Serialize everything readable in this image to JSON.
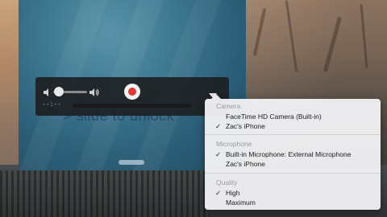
{
  "lock_screen": {
    "unlock_text": "> slide to unlock"
  },
  "controller": {
    "time": "--:--",
    "icons": {
      "volume_low": "speaker-low-icon",
      "volume_high": "speaker-high-icon",
      "record": "record-icon",
      "menu": "chevron-down-icon"
    },
    "volume_level": 0.05,
    "record_color": "#e03a34"
  },
  "menu": {
    "sections": [
      {
        "header": "Camera",
        "items": [
          {
            "label": "FaceTime HD Camera (Built-in)",
            "checked": false
          },
          {
            "label": "Zac's iPhone",
            "checked": true
          }
        ]
      },
      {
        "header": "Microphone",
        "items": [
          {
            "label": "Built-in Microphone: External Microphone",
            "checked": true
          },
          {
            "label": "Zac's iPhone",
            "checked": false
          }
        ]
      },
      {
        "header": "Quality",
        "items": [
          {
            "label": "High",
            "checked": true
          },
          {
            "label": "Maximum",
            "checked": false
          }
        ]
      }
    ],
    "check_glyph": "✓"
  }
}
